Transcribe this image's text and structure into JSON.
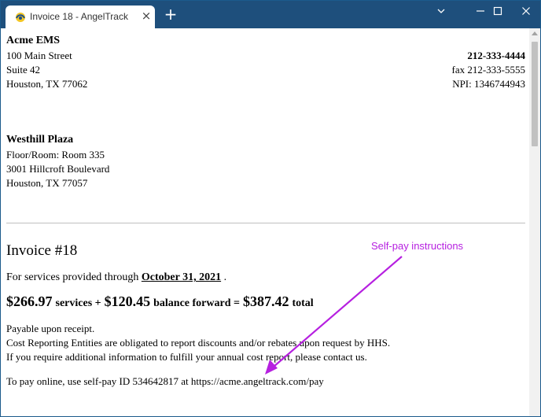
{
  "browser": {
    "tab_title": "Invoice 18 - AngelTrack",
    "new_tab_symbol": "+",
    "close_symbol": "×"
  },
  "sender": {
    "name": "Acme EMS",
    "address1": "100 Main Street",
    "address2": "Suite 42",
    "city_line": "Houston, TX 77062",
    "phone": "212-333-4444",
    "fax": "fax 212-333-5555",
    "npi": "NPI: 1346744943"
  },
  "recipient": {
    "name": "Westhill Plaza",
    "room": "Floor/Room: Room 335",
    "address": "3001 Hillcroft Boulevard",
    "city_line": "Houston, TX 77057"
  },
  "invoice": {
    "title": "Invoice #18",
    "services_prefix": "For services provided through",
    "services_date": "October 31, 2021",
    "services_suffix": ".",
    "services_amount": "$266.97",
    "services_label": "services +",
    "balance_amount": "$120.45",
    "balance_label": "balance forward =",
    "total_amount": "$387.42",
    "total_label": "total",
    "payable": "Payable upon receipt.",
    "cost_reporting": "Cost Reporting Entities are obligated to report discounts and/or rebates upon request by HHS.",
    "additional_info": "If you require additional information to fulfill your annual cost report, please contact us.",
    "self_pay": "To pay online, use self-pay ID 534642817 at https://acme.angeltrack.com/pay"
  },
  "annotation": {
    "label": "Self-pay instructions",
    "color": "#b620e0"
  },
  "colors": {
    "titlebar": "#1e4f7c",
    "accent": "#b620e0"
  }
}
